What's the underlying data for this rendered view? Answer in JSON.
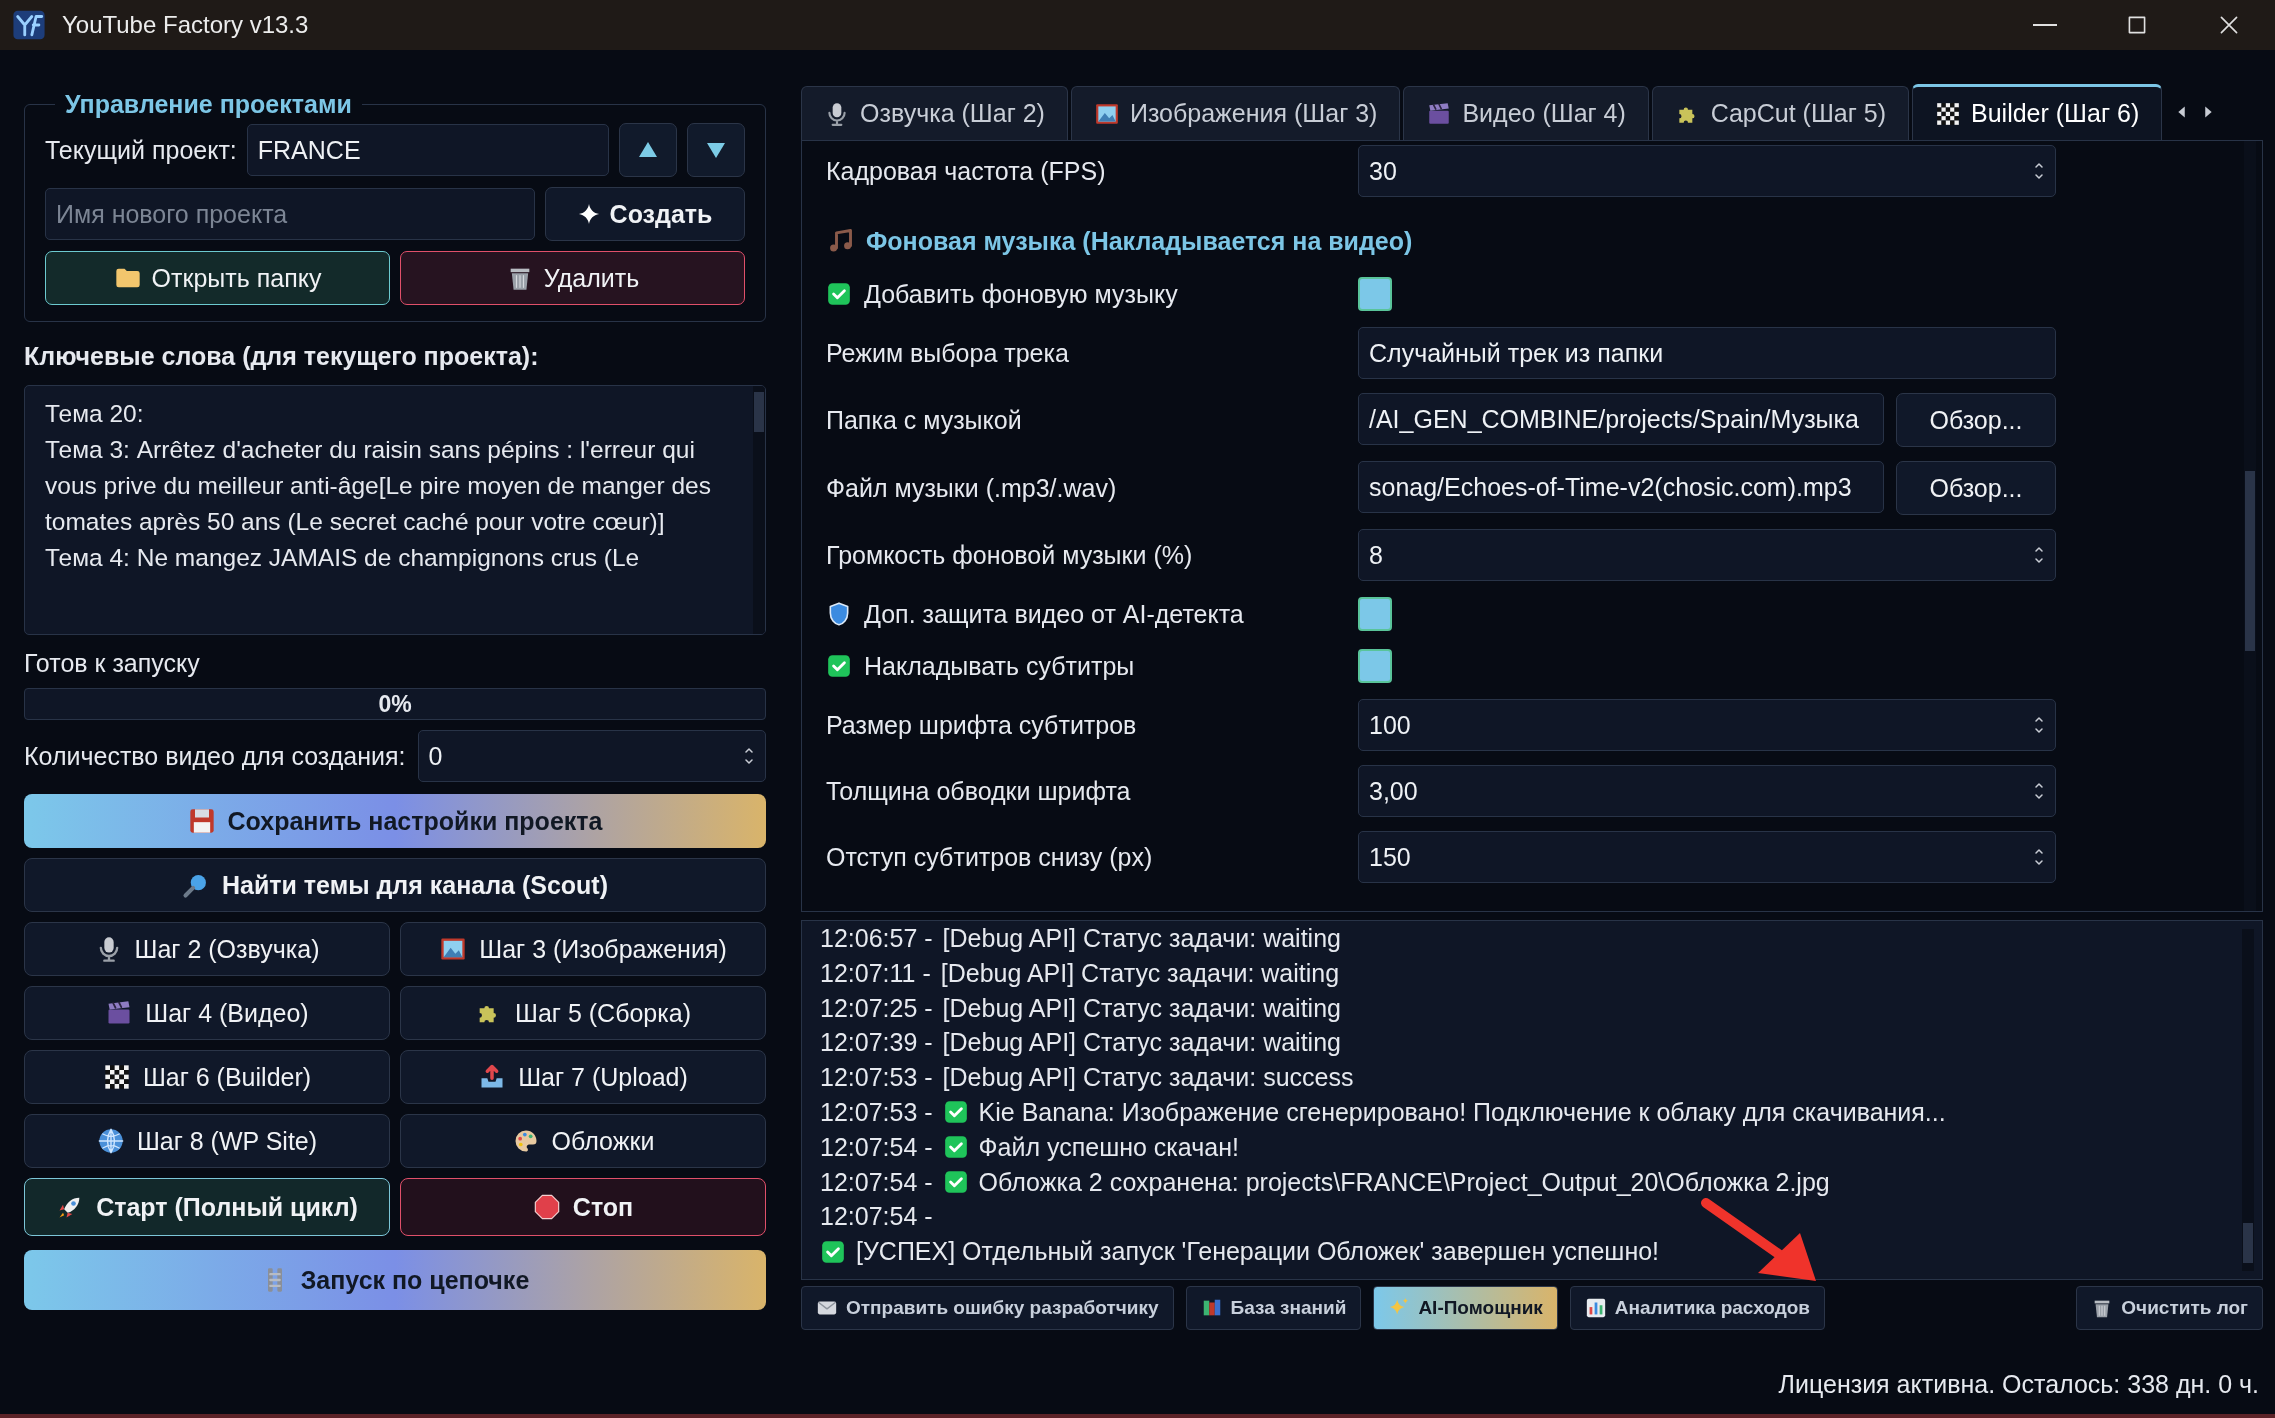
{
  "window": {
    "title": "YouTube Factory v13.3"
  },
  "project_group": {
    "title": "Управление проектами",
    "current_label": "Текущий проект:",
    "current_value": "FRANCE",
    "new_placeholder": "Имя нового проекта",
    "create": "Создать",
    "open_folder": "Открыть папку",
    "delete": "Удалить"
  },
  "keywords": {
    "heading": "Ключевые слова (для текущего проекта):",
    "lines": [
      "Тема 20:",
      "Тема 3: Arrêtez d'acheter du raisin sans pépins : l'erreur qui vous prive du meilleur anti-âge[Le pire moyen de manger des tomates après 50 ans (Le secret caché pour votre cœur)]",
      "Тема 4: Ne mangez JAMAIS de champignons crus (Le"
    ]
  },
  "status_text": "Готов к запуску",
  "progress": {
    "level": 0,
    "text": "0%"
  },
  "video_count": {
    "label": "Количество видео для создания:",
    "value": "0"
  },
  "actions": [
    {
      "kind": "gradient",
      "label": "Сохранить настройки проекта",
      "wide": true
    },
    {
      "kind": "primary",
      "label": "Найти темы для канала (Scout)",
      "wide": true
    },
    {
      "kind": "step",
      "label": "Шаг 2 (Озвучка)",
      "wide": false
    },
    {
      "kind": "step",
      "label": "Шаг 3 (Изображения)",
      "wide": false
    },
    {
      "kind": "step",
      "label": "Шаг 4 (Видео)",
      "wide": false
    },
    {
      "kind": "step",
      "label": "Шаг 5 (Сборка)",
      "wide": false
    },
    {
      "kind": "step",
      "label": "Шаг 6 (Builder)",
      "wide": false
    },
    {
      "kind": "step",
      "label": "Шаг 7 (Upload)",
      "wide": false
    },
    {
      "kind": "step",
      "label": "Шаг 8 (WP Site)",
      "wide": false
    },
    {
      "kind": "step",
      "label": "Обложки",
      "wide": false
    },
    {
      "kind": "start",
      "label": "Старт (Полный цикл)",
      "wide": false
    },
    {
      "kind": "stop",
      "label": "Стоп",
      "wide": false
    },
    {
      "kind": "gradient",
      "label": "Запуск по цепочке",
      "wide": true
    }
  ],
  "tabs": [
    {
      "label": "Озвучка (Шаг 2)",
      "selected": false
    },
    {
      "label": "Изображения (Шаг 3)",
      "selected": false
    },
    {
      "label": "Видео (Шаг 4)",
      "selected": false
    },
    {
      "label": "CapCut (Шаг 5)",
      "selected": false
    },
    {
      "label": "Builder (Шаг 6)",
      "selected": true
    }
  ],
  "settings": [
    {
      "kind": "spin",
      "label": "Кадровая частота (FPS)",
      "value": "30"
    },
    {
      "kind": "section",
      "label": "Фоновая музыка (Накладывается на видео)"
    },
    {
      "kind": "checkbox",
      "label": "Добавить фоновую музыку",
      "checked": true
    },
    {
      "kind": "select",
      "label": "Режим выбора трека",
      "value": "Случайный трек из папки"
    },
    {
      "kind": "path",
      "label": "Папка с музыкой",
      "value": "/AI_GEN_COMBINE/projects/Spain/Музыка",
      "button": "Обзор..."
    },
    {
      "kind": "path",
      "label": "Файл музыки (.mp3/.wav)",
      "value": "sonag/Echoes-of-Time-v2(chosic.com).mp3",
      "button": "Обзор..."
    },
    {
      "kind": "spin",
      "label": "Громкость фоновой музыки (%)",
      "value": "8"
    },
    {
      "kind": "shieldbox",
      "label": "Доп. защита видео от AI-детекта",
      "checked": true
    },
    {
      "kind": "checkbox",
      "label": "Накладывать субтитры",
      "checked": true
    },
    {
      "kind": "spin",
      "label": "Размер шрифта субтитров",
      "value": "100"
    },
    {
      "kind": "spin",
      "label": "Толщина обводки шрифта",
      "value": "3,00"
    },
    {
      "kind": "spin",
      "label": "Отступ субтитров снизу (px)",
      "value": "150"
    }
  ],
  "log": [
    {
      "time": "12:06:57 -",
      "ok": false,
      "text": "[Debug API] Статус задачи: waiting"
    },
    {
      "time": "12:07:11 -",
      "ok": false,
      "text": "[Debug API] Статус задачи: waiting"
    },
    {
      "time": "12:07:25 -",
      "ok": false,
      "text": "[Debug API] Статус задачи: waiting"
    },
    {
      "time": "12:07:39 -",
      "ok": false,
      "text": "[Debug API] Статус задачи: waiting"
    },
    {
      "time": "12:07:53 -",
      "ok": false,
      "text": "[Debug API] Статус задачи: success"
    },
    {
      "time": "12:07:53 -",
      "ok": true,
      "text": "Kie Banana: Изображение сгенерировано! Подключение к облаку для скачивания..."
    },
    {
      "time": "12:07:54 -",
      "ok": true,
      "text": "Файл успешно скачан!"
    },
    {
      "time": "12:07:54 -",
      "ok": true,
      "text": "Обложка 2 сохранена: projects\\FRANCE\\Project_Output_20\\Обложка 2.jpg"
    },
    {
      "time": "12:07:54 -",
      "ok": false
    },
    {
      "ok": true,
      "text": "[УСПЕХ] Отдельный запуск 'Генерации Обложек' завершен успешно!"
    }
  ],
  "log_buttons": [
    {
      "kind": "plain",
      "label": "Отправить ошибку разработчику"
    },
    {
      "kind": "plain",
      "label": "База знаний"
    },
    {
      "kind": "accent",
      "label": "AI-Помощник"
    },
    {
      "kind": "plain",
      "label": "Аналитика расходов"
    },
    {
      "kind": "right",
      "label": "Очистить лог"
    }
  ],
  "status_bar": "Лицензия активна. Осталось: 338 дн. 0 ч."
}
